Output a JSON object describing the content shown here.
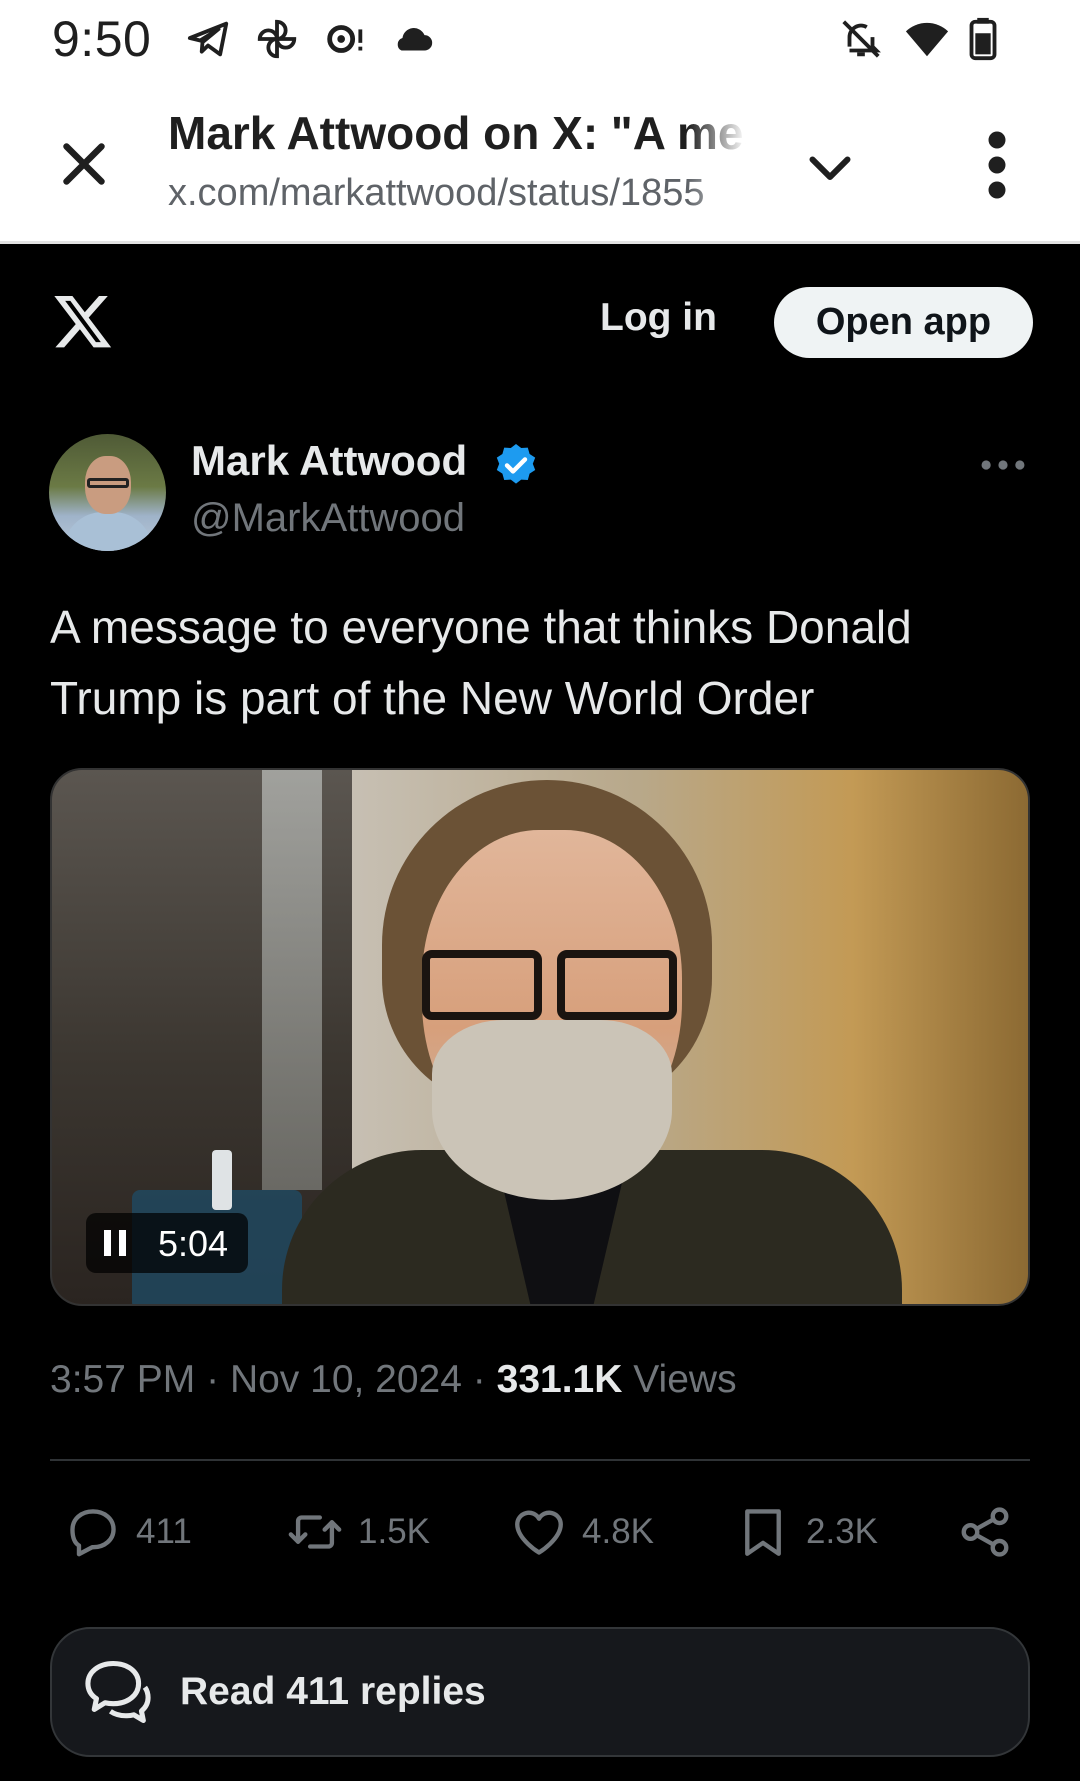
{
  "status_bar": {
    "time": "9:50",
    "left_icons": [
      "telegram-icon",
      "pinwheel-icon",
      "chat-alert-icon",
      "cloud-icon"
    ],
    "right_icons": [
      "bell-off-icon",
      "wifi-icon",
      "battery-icon"
    ]
  },
  "toolbar": {
    "title": "Mark Attwood on X: \"A message to everyone that thinks Donald Trump is part of the New World Order\"",
    "url": "x.com/markattwood/status/1855"
  },
  "x_header": {
    "login_label": "Log in",
    "open_app_label": "Open app"
  },
  "tweet": {
    "author_name": "Mark Attwood",
    "author_handle": "@MarkAttwood",
    "text": "A message to everyone that thinks Donald Trump is part of the New World Order",
    "video_time": "5:04",
    "time": "3:57 PM",
    "date": "Nov 10, 2024",
    "views_count": "331.1K",
    "views_label": "Views",
    "separator": "·",
    "replies": "411",
    "reposts": "1.5K",
    "likes": "4.8K",
    "bookmarks": "2.3K",
    "read_replies_label": "Read 411 replies"
  },
  "colors": {
    "background": "#000000",
    "text_primary": "#e7e9ea",
    "text_secondary": "#71767b",
    "verified_blue": "#1d9bf0",
    "button_light": "#eff3f4"
  }
}
